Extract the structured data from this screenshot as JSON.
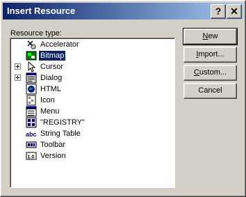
{
  "window": {
    "title": "Insert Resource",
    "help_icon": "question-mark-icon",
    "close_icon": "close-x-icon"
  },
  "resource_type": {
    "label": "Resource type:",
    "items": [
      {
        "label": "Accelerator",
        "icon": "accelerator-icon",
        "expandable": false,
        "selected": false
      },
      {
        "label": "Bitmap",
        "icon": "bitmap-icon",
        "expandable": false,
        "selected": true
      },
      {
        "label": "Cursor",
        "icon": "cursor-icon",
        "expandable": true,
        "selected": false
      },
      {
        "label": "Dialog",
        "icon": "dialog-icon",
        "expandable": true,
        "selected": false
      },
      {
        "label": "HTML",
        "icon": "html-icon",
        "expandable": false,
        "selected": false
      },
      {
        "label": "Icon",
        "icon": "icon-resource-icon",
        "expandable": false,
        "selected": false
      },
      {
        "label": "Menu",
        "icon": "menu-icon",
        "expandable": false,
        "selected": false
      },
      {
        "label": "\"REGISTRY\"",
        "icon": "registry-icon",
        "expandable": false,
        "selected": false
      },
      {
        "label": "String Table",
        "icon": "string-table-icon",
        "expandable": false,
        "selected": false
      },
      {
        "label": "Toolbar",
        "icon": "toolbar-icon",
        "expandable": false,
        "selected": false
      },
      {
        "label": "Version",
        "icon": "version-icon",
        "expandable": false,
        "selected": false
      }
    ]
  },
  "buttons": {
    "new": {
      "mnemonic": "N",
      "rest": "ew"
    },
    "import": {
      "mnemonic": "I",
      "rest": "mport..."
    },
    "custom": {
      "mnemonic": "C",
      "rest": "ustom..."
    },
    "cancel": "Cancel"
  }
}
